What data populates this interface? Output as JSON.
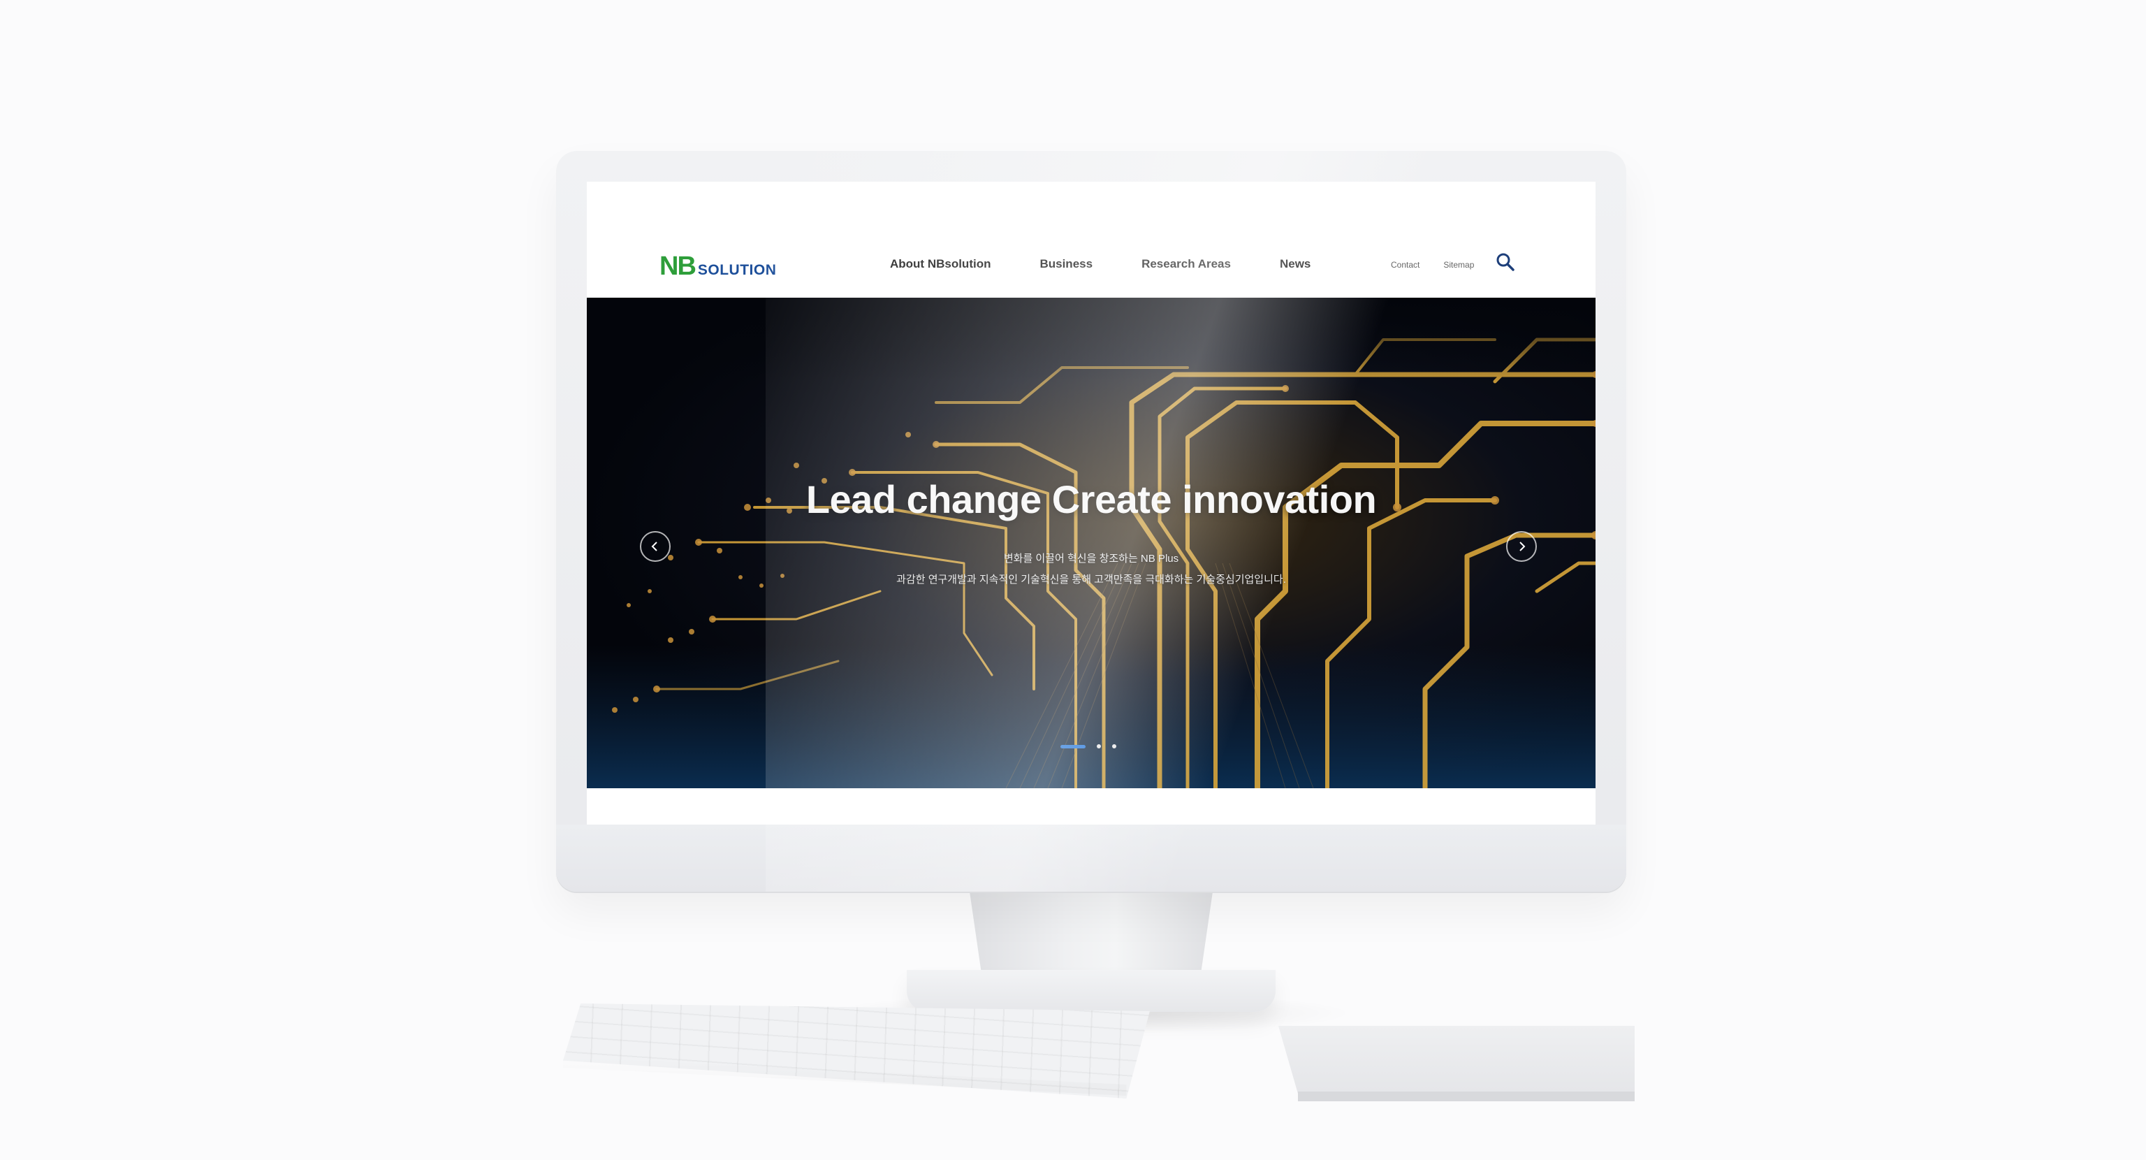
{
  "logo": {
    "mark": "NB",
    "word": "SOLUTION"
  },
  "nav": {
    "items": [
      "About NBsolution",
      "Business",
      "Research Areas",
      "News"
    ]
  },
  "utility": {
    "contact": "Contact",
    "sitemap": "Sitemap"
  },
  "search": {
    "icon": "search-icon"
  },
  "hero": {
    "title": "Lead change Create innovation",
    "subtitle_line1": "변화를 이끌어 혁신을 창조하는 NB Plus",
    "subtitle_line2": "과감한 연구개발과 지속적인 기술혁신을 통해 고객만족을 극대화하는 기술중심기업입니다.",
    "prev_icon": "chevron-left-icon",
    "next_icon": "chevron-right-icon",
    "slide_count": 3,
    "active_slide": 1
  },
  "colors": {
    "logo_green": "#2e9e3a",
    "logo_blue": "#1d4f9a",
    "dot_active": "#1f73d8",
    "circuit_gold": "#d8a53a"
  }
}
